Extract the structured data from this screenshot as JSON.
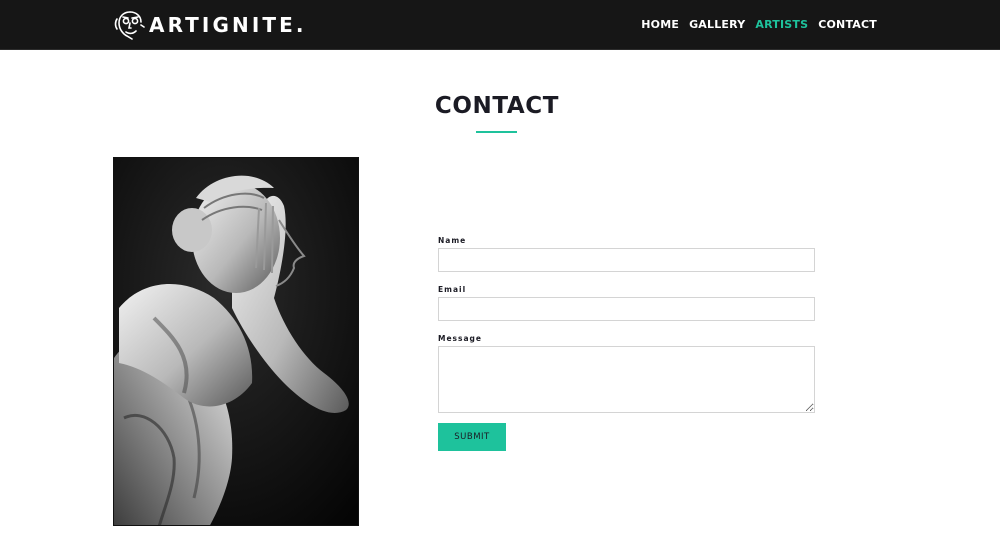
{
  "brand": {
    "name": "ARTIGNITE."
  },
  "nav": {
    "items": [
      {
        "label": "HOME",
        "active": false
      },
      {
        "label": "GALLERY",
        "active": false
      },
      {
        "label": "ARTISTS",
        "active": true
      },
      {
        "label": "CONTACT",
        "active": false
      }
    ]
  },
  "page": {
    "title": "CONTACT"
  },
  "image": {
    "subject": "black and white marble statue of a woman with hand raised to her ear"
  },
  "form": {
    "name_label": "Name",
    "name_value": "",
    "email_label": "Email",
    "email_value": "",
    "message_label": "Message",
    "message_value": "",
    "submit_label": "SUBMIT"
  },
  "colors": {
    "accent": "#1ec29c",
    "navbar_bg": "#161616",
    "text_dark": "#1b1b24",
    "input_border": "#d4d4d4"
  }
}
